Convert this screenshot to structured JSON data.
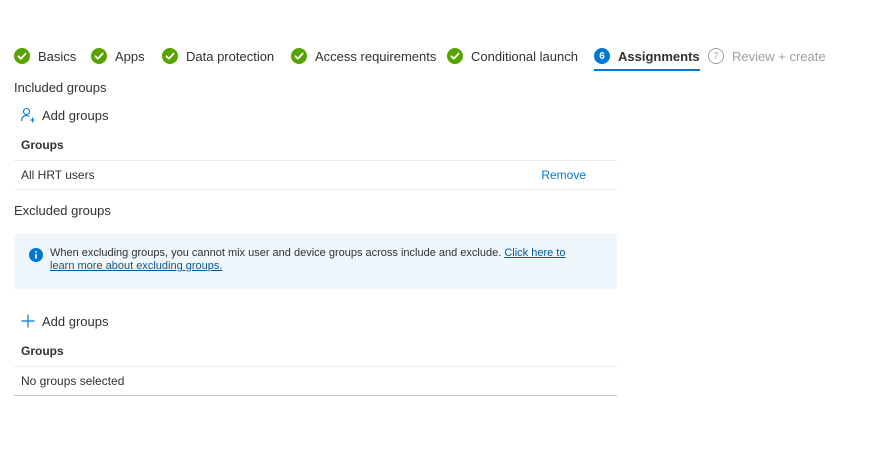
{
  "wizard": {
    "steps": [
      {
        "label": "Basics",
        "state": "done"
      },
      {
        "label": "Apps",
        "state": "done"
      },
      {
        "label": "Data protection",
        "state": "done"
      },
      {
        "label": "Access requirements",
        "state": "done"
      },
      {
        "label": "Conditional launch",
        "state": "done"
      },
      {
        "label": "Assignments",
        "state": "current",
        "number": "6"
      },
      {
        "label": "Review + create",
        "state": "disabled",
        "number": "7"
      }
    ]
  },
  "included": {
    "title": "Included groups",
    "add_label": "Add groups",
    "column_header": "Groups",
    "rows": [
      {
        "name": "All HRT users",
        "action": "Remove"
      }
    ]
  },
  "excluded": {
    "title": "Excluded groups",
    "info_text": "When excluding groups, you cannot mix user and device groups across include and exclude.",
    "info_link": "Click here to learn more about excluding groups.",
    "add_label": "Add groups",
    "column_header": "Groups",
    "empty_text": "No groups selected"
  },
  "colors": {
    "success": "#57a300",
    "accent": "#0078d4",
    "info_bg": "#eff6fc",
    "disabled": "#a19f9d"
  },
  "icons": {
    "done": "checkmark-circle-icon",
    "add_included": "add-user-icon",
    "add_excluded": "plus-icon",
    "info": "info-icon"
  }
}
